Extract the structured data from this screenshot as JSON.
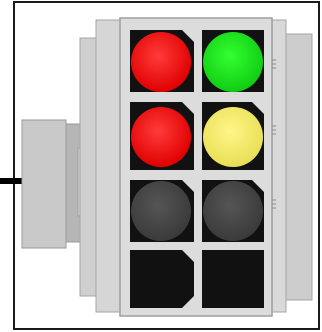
{
  "colors": {
    "frame_border": "#1a1a1a",
    "housing_light": "#d9d9d9",
    "housing_mid": "#c4c4c4",
    "housing_dark": "#a8a8a8",
    "cavity": "#111111",
    "red": "#ff1a1a",
    "green": "#19e619",
    "yellow": "#f6ee6a",
    "dark_gray": "#4a4a4a",
    "pointer": "#000000"
  },
  "indicators": [
    {
      "name": "row1-left",
      "state": "red"
    },
    {
      "name": "row1-right",
      "state": "green"
    },
    {
      "name": "row2-left",
      "state": "red"
    },
    {
      "name": "row2-right",
      "state": "yellow"
    },
    {
      "name": "row3-left",
      "state": "off"
    },
    {
      "name": "row3-right",
      "state": "off"
    },
    {
      "name": "row4-left",
      "state": "empty"
    },
    {
      "name": "row4-right",
      "state": "empty"
    }
  ]
}
